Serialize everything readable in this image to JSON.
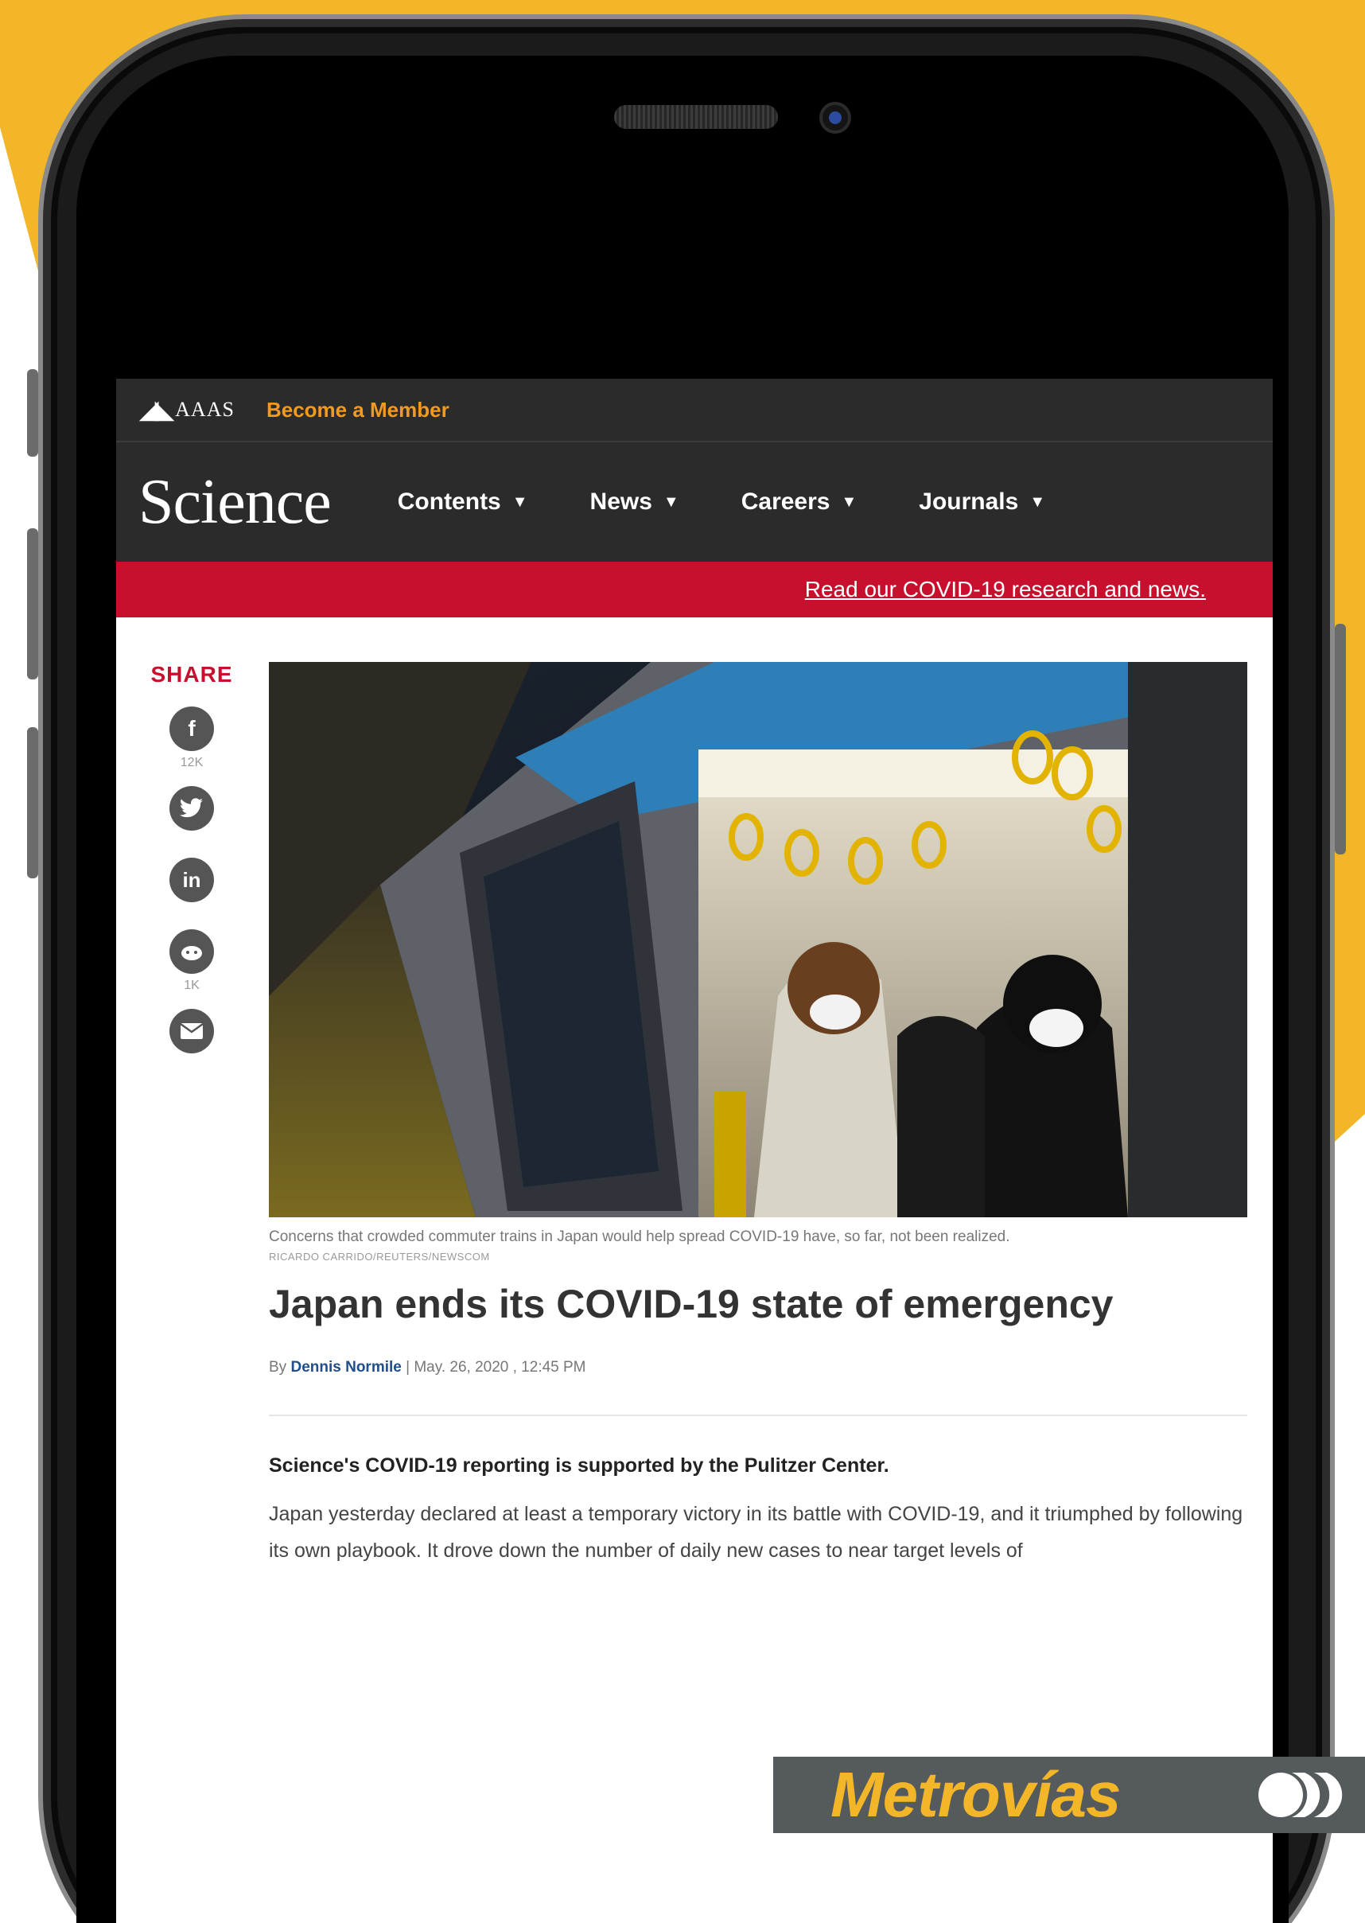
{
  "aaas": {
    "logo_text": "AAAS",
    "member_link": "Become a Member"
  },
  "science": {
    "logo": "Science"
  },
  "nav": {
    "items": [
      {
        "label": "Contents"
      },
      {
        "label": "News"
      },
      {
        "label": "Careers"
      },
      {
        "label": "Journals"
      }
    ]
  },
  "covid_banner": {
    "link": "Read our COVID-19 research and news."
  },
  "share": {
    "label": "SHARE",
    "facebook_count": "12K",
    "reddit_count": "1K",
    "icons": [
      "facebook-icon",
      "twitter-icon",
      "linkedin-icon",
      "reddit-icon",
      "email-icon"
    ]
  },
  "article": {
    "caption": "Concerns that crowded commuter trains in Japan would help spread COVID-19 have, so far, not been realized.",
    "credit": "RICARDO CARRIDO/REUTERS/NEWSCOM",
    "headline": "Japan ends its COVID-19 state of emergency",
    "byline_prefix": "By",
    "author": "Dennis Normile",
    "date": "May. 26, 2020 , 12:45 PM",
    "supported": "Science's COVID-19 reporting is supported by the Pulitzer Center.",
    "body": "Japan yesterday declared at least a temporary victory in its battle with COVID-19, and it triumphed by following its own playbook. It drove down the number of daily new cases to near target levels of"
  },
  "brand": {
    "metrovias": "Metrovías"
  },
  "colors": {
    "background": "#f2b628",
    "science_red": "#c8102e",
    "member_orange": "#f29a1e",
    "navbar": "#2b2b2b"
  }
}
